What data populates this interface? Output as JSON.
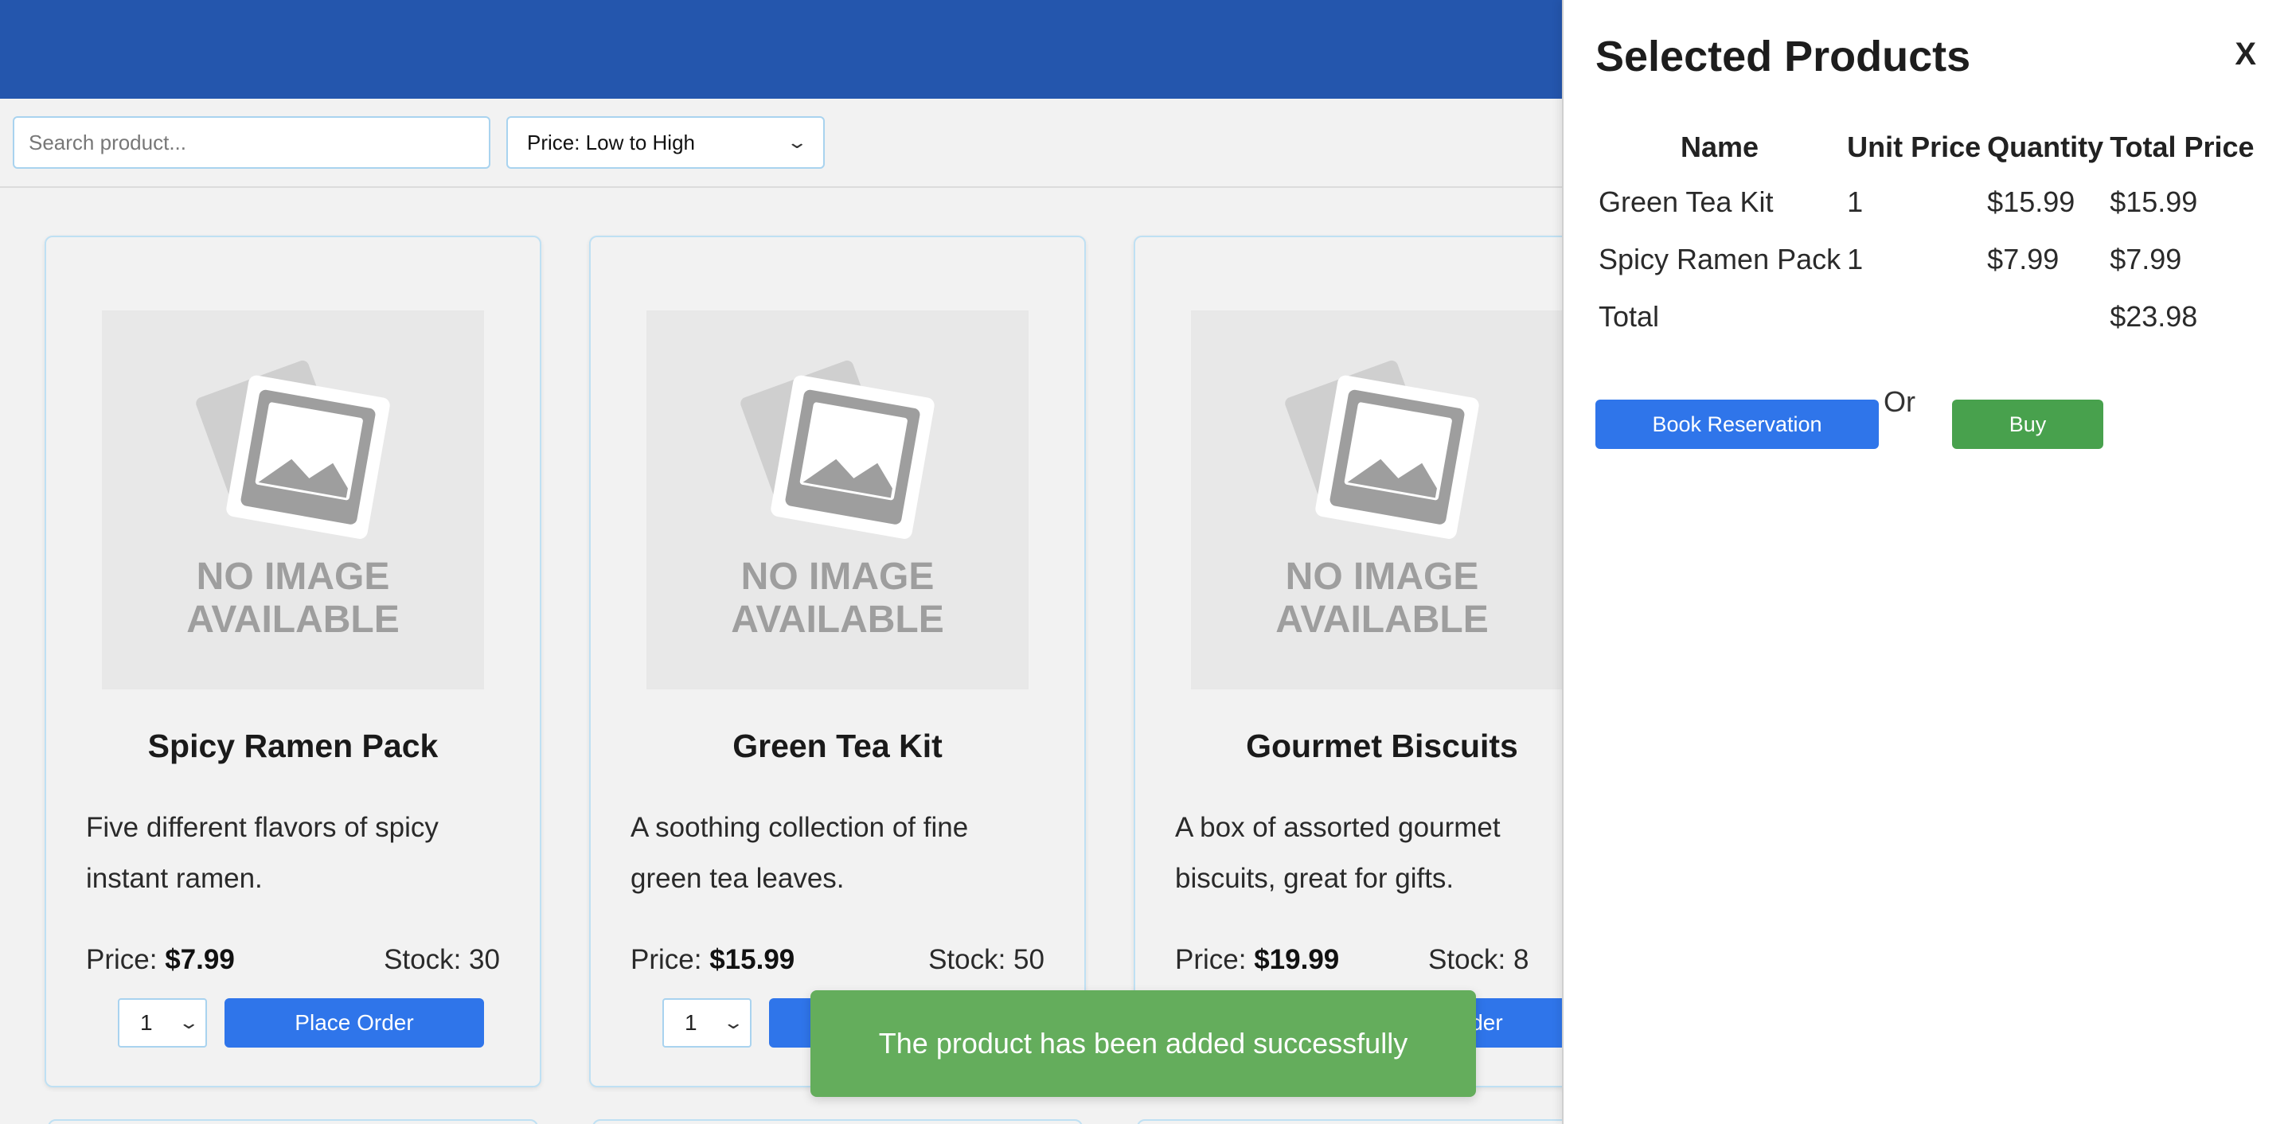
{
  "search": {
    "placeholder": "Search product..."
  },
  "sort": {
    "selected": "Price: Low to High"
  },
  "products": [
    {
      "name": "Spicy Ramen Pack",
      "description": "Five different flavors of spicy instant ramen.",
      "price_label": "Price: ",
      "price": "$7.99",
      "stock": "Stock: 30",
      "qty": "1",
      "order_label": "Place Order"
    },
    {
      "name": "Green Tea Kit",
      "description": "A soothing collection of fine green tea leaves.",
      "price_label": "Price: ",
      "price": "$15.99",
      "stock": "Stock: 50",
      "qty": "1",
      "order_label": "Place Order"
    },
    {
      "name": "Gourmet Biscuits",
      "description": "A box of assorted gourmet biscuits, great for gifts.",
      "price_label": "Price: ",
      "price": "$19.99",
      "stock": "Stock: 8",
      "qty": "1",
      "order_label": "Place Order"
    }
  ],
  "no_image": {
    "line1": "NO IMAGE",
    "line2": "AVAILABLE"
  },
  "cart": {
    "title": "Selected Products",
    "close_label": "X",
    "headers": [
      "Name",
      "Unit Price",
      "Quantity",
      "Total Price"
    ],
    "rows": [
      [
        "Green Tea Kit",
        "1",
        "$15.99",
        "$15.99"
      ],
      [
        "Spicy Ramen Pack",
        "1",
        "$7.99",
        "$7.99"
      ]
    ],
    "total_label": "Total",
    "total_value": "$23.98",
    "reserve_label": "Book Reservation",
    "or_label": "Or",
    "buy_label": "Buy"
  },
  "toast": {
    "message": "The product has been added successfully"
  },
  "colors": {
    "topbar": "#2456ad",
    "primary": "#2f75ea",
    "buy": "#48a14d",
    "toast": "#64ad5c"
  }
}
